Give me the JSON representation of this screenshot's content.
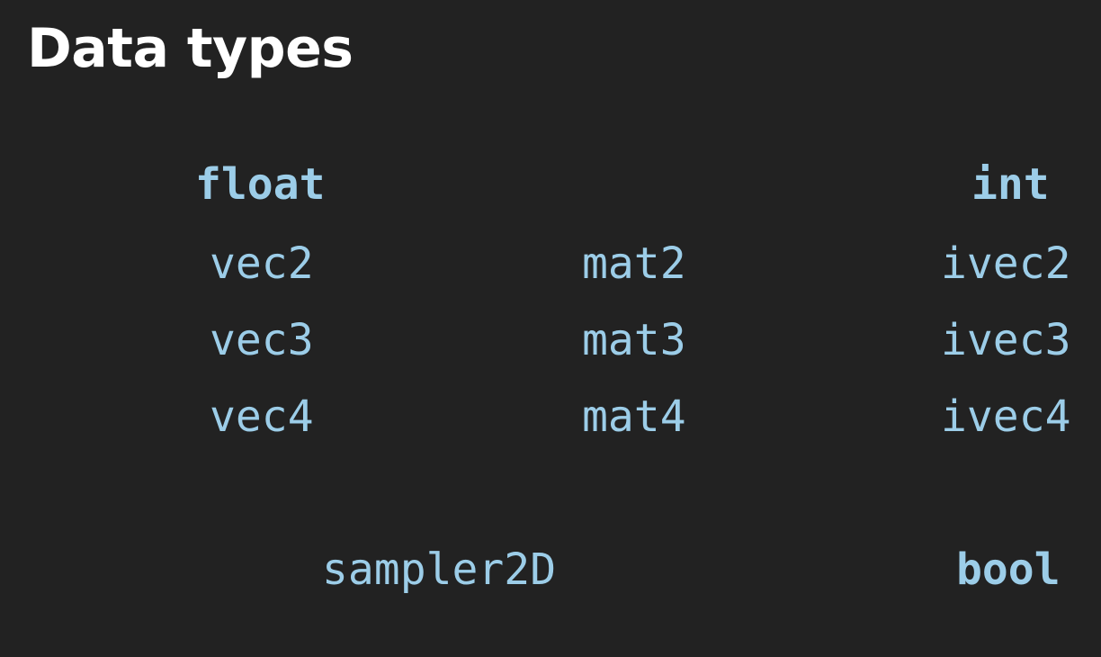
{
  "title": "Data types",
  "colors": {
    "background": "#222222",
    "title": "#ffffff",
    "keyword": "#9ccde8"
  },
  "types": {
    "float": "float",
    "int": "int",
    "vec2": "vec2",
    "vec3": "vec3",
    "vec4": "vec4",
    "mat2": "mat2",
    "mat3": "mat3",
    "mat4": "mat4",
    "ivec2": "ivec2",
    "ivec3": "ivec3",
    "ivec4": "ivec4",
    "sampler2D": "sampler2D",
    "bool": "bool"
  }
}
